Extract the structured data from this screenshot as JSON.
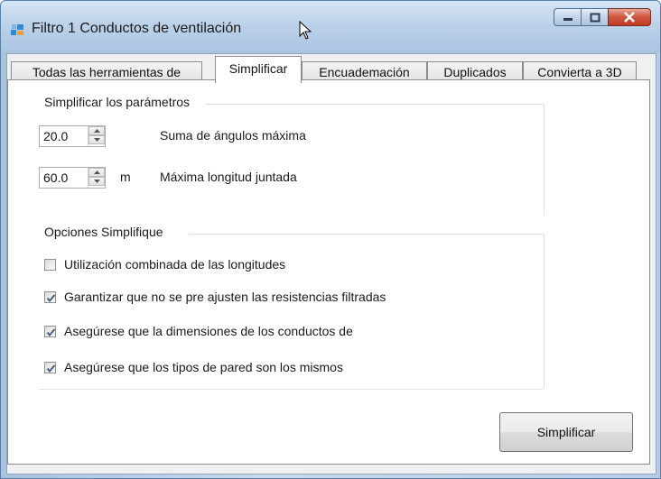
{
  "window": {
    "title": "Filtro  1 Conductos de ventilación",
    "icon": "app-window-icon",
    "caption_buttons": [
      "minimize-icon",
      "maximize-icon",
      "close-icon"
    ]
  },
  "tabs": [
    {
      "label": "Todas las herramientas de",
      "active": false
    },
    {
      "label": "Simplificar",
      "active": true
    },
    {
      "label": "Encuademación",
      "active": false
    },
    {
      "label": "Duplicados",
      "active": false
    },
    {
      "label": "Convierta a 3D",
      "active": false
    }
  ],
  "parameters": {
    "group_title": "Simplificar los parámetros",
    "angle": {
      "value": "20.0",
      "unit": "",
      "label": "Suma de ángulos máxima"
    },
    "length": {
      "value": "60.0",
      "unit": "m",
      "label": "Máxima longitud juntada"
    }
  },
  "options": {
    "group_title": "Opciones Simplifique",
    "items": [
      {
        "label": "Utilización combinada de las longitudes",
        "checked": false
      },
      {
        "label": "Garantizar que no se pre ajusten las resistencias filtradas",
        "checked": true
      },
      {
        "label": "Asegúrese que la dimensiones de los conductos de",
        "checked": true
      },
      {
        "label": "Asegúrese que los tipos de pared son los mismos",
        "checked": true
      }
    ]
  },
  "actions": {
    "simplify_label": "Simplificar"
  },
  "colors": {
    "title_bar": "#bcd2ea",
    "close_button": "#c23b23",
    "panel_bg": "#ffffff",
    "checkmark": "#4a5f7a"
  }
}
